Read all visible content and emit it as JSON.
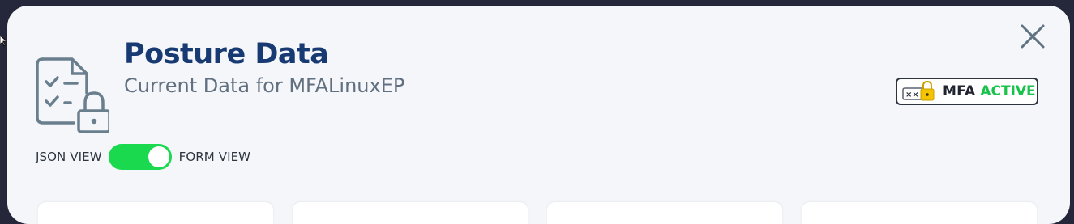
{
  "modal": {
    "title": "Posture Data",
    "subtitle": "Current Data for MFALinuxEP",
    "header_icon": "checklist-lock-icon",
    "close_icon": "close-icon"
  },
  "mfa_badge": {
    "icon": "mfa-lock-icon",
    "label": "MFA",
    "status": "ACTIVE",
    "status_color": "#19c24a"
  },
  "view_toggle": {
    "left_label": "JSON VIEW",
    "right_label": "FORM VIEW",
    "state": "on",
    "color": "#1bd94f"
  },
  "colors": {
    "title": "#173a73",
    "subtitle": "#607080",
    "modal_background": "#f5f6fa",
    "backdrop": "#25273a"
  }
}
